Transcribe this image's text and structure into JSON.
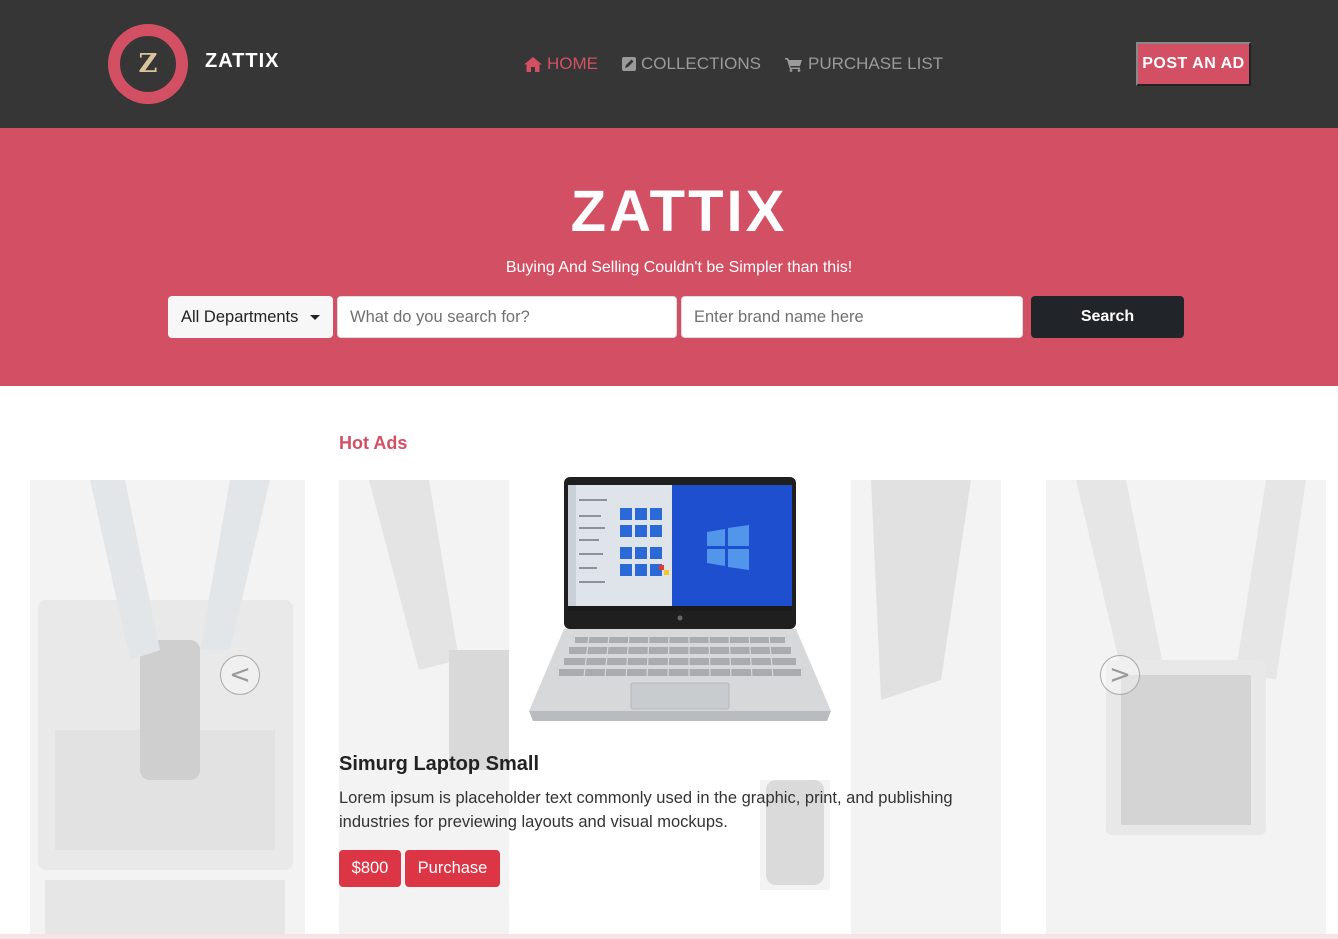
{
  "header": {
    "logo_letter": "Z",
    "brand": "ZATTIX",
    "nav": [
      {
        "label": "HOME",
        "icon": "home-icon",
        "active": true
      },
      {
        "label": "COLLECTIONS",
        "icon": "edit-icon",
        "active": false
      },
      {
        "label": "PURCHASE LIST",
        "icon": "cart-icon",
        "active": false
      }
    ],
    "post_button": "POST AN AD"
  },
  "hero": {
    "title": "ZATTIX",
    "subtitle": "Buying And Selling Couldn't be Simpler than this!",
    "department_select": "All Departments",
    "search_placeholder": "What do you search for?",
    "brand_placeholder": "Enter brand name here",
    "search_button": "Search"
  },
  "hot_ads": {
    "section_title": "Hot Ads",
    "prev_arrow": "<",
    "next_arrow": ">",
    "product": {
      "title": "Simurg Laptop Small",
      "description": "Lorem ipsum is placeholder text commonly used in the graphic, print, and publishing industries for previewing layouts and visual mockups.",
      "price": "$800",
      "purchase_button": "Purchase"
    }
  },
  "colors": {
    "accent": "#d35064",
    "navbar": "#363636",
    "dark_button": "#212529",
    "danger": "#dc3545"
  }
}
